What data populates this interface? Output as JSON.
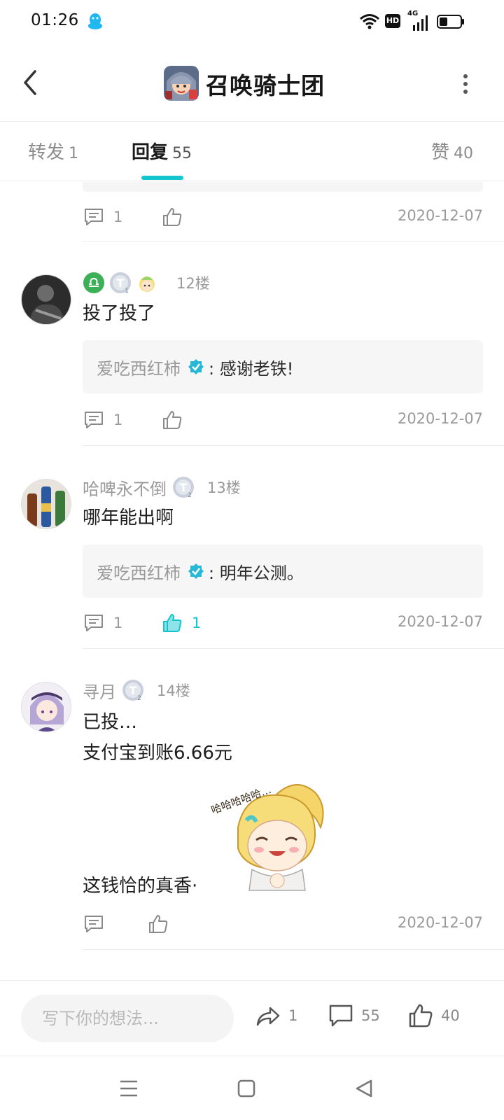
{
  "status_bar": {
    "time": "01:26",
    "hd_label": "HD",
    "network_label": "4G",
    "icons": [
      "qq-icon",
      "wifi-icon",
      "hd-icon",
      "signal-icon",
      "battery-icon"
    ]
  },
  "header": {
    "title": "召唤骑士团",
    "back_icon": "chevron-left-icon",
    "more_icon": "more-vertical-icon"
  },
  "tabs": [
    {
      "label": "转发",
      "count": "1",
      "active": false
    },
    {
      "label": "回复",
      "count": "55",
      "active": true
    },
    {
      "label": "赞",
      "count": "40",
      "active": false
    }
  ],
  "colors": {
    "accent": "#15c5ce",
    "muted_text": "#9a9a9a",
    "reply_bg": "#f6f6f6"
  },
  "top_partial": {
    "comment_count": "1",
    "date": "2020-12-07"
  },
  "comments": [
    {
      "username": "",
      "badges": [
        "libra-badge-icon",
        "level-badge-icon",
        "character-badge-icon"
      ],
      "level_sub": "1",
      "floor": "12楼",
      "lines": [
        "投了投了"
      ],
      "reply": {
        "author": "爱吃西红柿",
        "text": ": 感谢老铁!"
      },
      "comment_count": "1",
      "like_count": "",
      "liked": false,
      "date": "2020-12-07"
    },
    {
      "username": "哈啤永不倒",
      "badges": [
        "level-badge-icon"
      ],
      "level_sub": "2",
      "floor": "13楼",
      "lines": [
        "哪年能出啊"
      ],
      "reply": {
        "author": "爱吃西红柿",
        "text": ": 明年公测。"
      },
      "comment_count": "1",
      "like_count": "1",
      "liked": true,
      "date": "2020-12-07"
    },
    {
      "username": "寻月",
      "badges": [
        "level-badge-icon"
      ],
      "level_sub": "2",
      "floor": "14楼",
      "lines": [
        "已投…",
        "支付宝到账6.66元",
        "这钱恰的真香·"
      ],
      "sticker_text": "哈哈哈哈哈…",
      "comment_count": "",
      "like_count": "",
      "liked": false,
      "date": "2020-12-07"
    }
  ],
  "bottom_bar": {
    "placeholder": "写下你的想法...",
    "share_count": "1",
    "comment_count": "55",
    "like_count": "40"
  },
  "nav": {
    "icons": [
      "menu-icon",
      "home-square-icon",
      "back-triangle-icon"
    ]
  }
}
